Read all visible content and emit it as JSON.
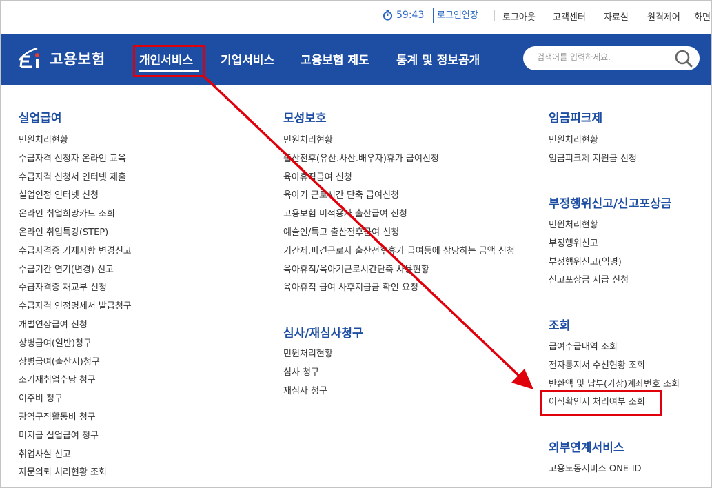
{
  "topbar": {
    "timer": "59:43",
    "extend_login": "로그인연장",
    "links": [
      "로그아웃",
      "고객센터",
      "자료실",
      "원격제어",
      "화면"
    ]
  },
  "header": {
    "logo_text": "고용보험",
    "nav": [
      "개인서비스",
      "기업서비스",
      "고용보험 제도",
      "통계 및 정보공개"
    ],
    "active_nav": "개인서비스",
    "search_placeholder": "검색어를 입력하세요."
  },
  "sections": {
    "unemployment": {
      "title": "실업급여",
      "items": [
        "민원처리현황",
        "수급자격 신청자 온라인 교육",
        "수급자격 신청서 인터넷 제출",
        "실업인정 인터넷 신청",
        "온라인 취업희망카드 조회",
        "온라인 취업특강(STEP)",
        "수급자격증 기재사항 변경신고",
        "수급기간 연기(변경) 신고",
        "수급자격증 재교부 신청",
        "수급자격 인정명세서 발급청구",
        "개별연장급여 신청",
        "상병급여(일반)청구",
        "상병급여(출산시)청구",
        "조기재취업수당 청구",
        "이주비 청구",
        "광역구직활동비 청구",
        "미지급 실업급여 청구",
        "취업사실 신고",
        "자문의뢰 처리현황 조회"
      ]
    },
    "maternity": {
      "title": "모성보호",
      "items": [
        "민원처리현황",
        "출산전후(유산.사산.배우자)휴가 급여신청",
        "육아휴직급여 신청",
        "육아기 근로시간 단축 급여신청",
        "고용보험 미적용자 출산급여 신청",
        "예술인/특고 출산전후급여 신청",
        "기간제.파견근로자 출산전후휴가 급여등에 상당하는 금액 신청",
        "육아휴직/육아기근로시간단축 사용현황",
        "육아휴직 급여 사후지급금 확인 요청"
      ]
    },
    "review": {
      "title": "심사/재심사청구",
      "items": [
        "민원처리현황",
        "심사 청구",
        "재심사 청구"
      ]
    },
    "wage_peak": {
      "title": "임금피크제",
      "items": [
        "민원처리현황",
        "임금피크제 지원금 신청"
      ]
    },
    "fraud": {
      "title": "부정행위신고/신고포상금",
      "items": [
        "민원처리현황",
        "부정행위신고",
        "부정행위신고(익명)",
        "신고포상금 지급 신청"
      ]
    },
    "inquiry": {
      "title": "조회",
      "items": [
        "급여수급내역 조회",
        "전자통지서 수신현황 조회",
        "반환액 및 납부(가상)계좌번호 조회",
        "이직확인서 처리여부 조회"
      ]
    },
    "external": {
      "title": "외부연계서비스",
      "items": [
        "고용노동서비스 ONE-ID"
      ]
    }
  },
  "annotation": {
    "color": "#e0000b",
    "from": "개인서비스",
    "to": "이직확인서 처리여부 조회"
  }
}
